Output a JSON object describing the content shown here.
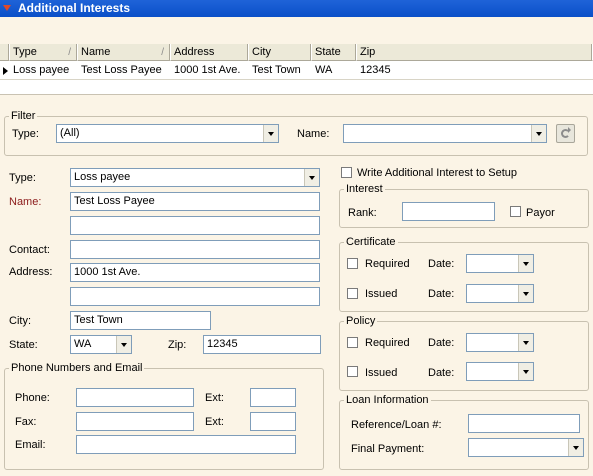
{
  "title": "Additional Interests",
  "grid": {
    "columns": [
      "Type",
      "Name",
      "Address",
      "City",
      "State",
      "Zip"
    ],
    "row": [
      "Loss payee",
      "Test Loss Payee",
      "1000 1st Ave.",
      "Test Town",
      "WA",
      "12345"
    ]
  },
  "filter": {
    "legend": "Filter",
    "type_label": "Type:",
    "type_value": "(All)",
    "name_label": "Name:",
    "name_value": ""
  },
  "form": {
    "type_label": "Type:",
    "type_value": "Loss payee",
    "name_label": "Name:",
    "name_value": "Test Loss Payee",
    "name2_value": "",
    "contact_label": "Contact:",
    "contact_value": "",
    "address_label": "Address:",
    "address_value": "1000 1st Ave.",
    "address2_value": "",
    "city_label": "City:",
    "city_value": "Test Town",
    "state_label": "State:",
    "state_value": "WA",
    "zip_label": "Zip:",
    "zip_value": "12345"
  },
  "phones": {
    "legend": "Phone Numbers and Email",
    "phone_label": "Phone:",
    "fax_label": "Fax:",
    "ext_label": "Ext:",
    "email_label": "Email:",
    "phone_value": "",
    "phone_ext": "",
    "fax_value": "",
    "fax_ext": "",
    "email_value": ""
  },
  "write_setup_label": "Write Additional Interest to Setup",
  "interest": {
    "legend": "Interest",
    "rank_label": "Rank:",
    "rank_value": "",
    "payor_label": "Payor"
  },
  "certificate": {
    "legend": "Certificate",
    "required_label": "Required",
    "issued_label": "Issued",
    "date_label": "Date:"
  },
  "policy": {
    "legend": "Policy",
    "required_label": "Required",
    "issued_label": "Issued",
    "date_label": "Date:"
  },
  "loan": {
    "legend": "Loan Information",
    "ref_label": "Reference/Loan #:",
    "ref_value": "",
    "final_label": "Final Payment:",
    "final_value": ""
  }
}
